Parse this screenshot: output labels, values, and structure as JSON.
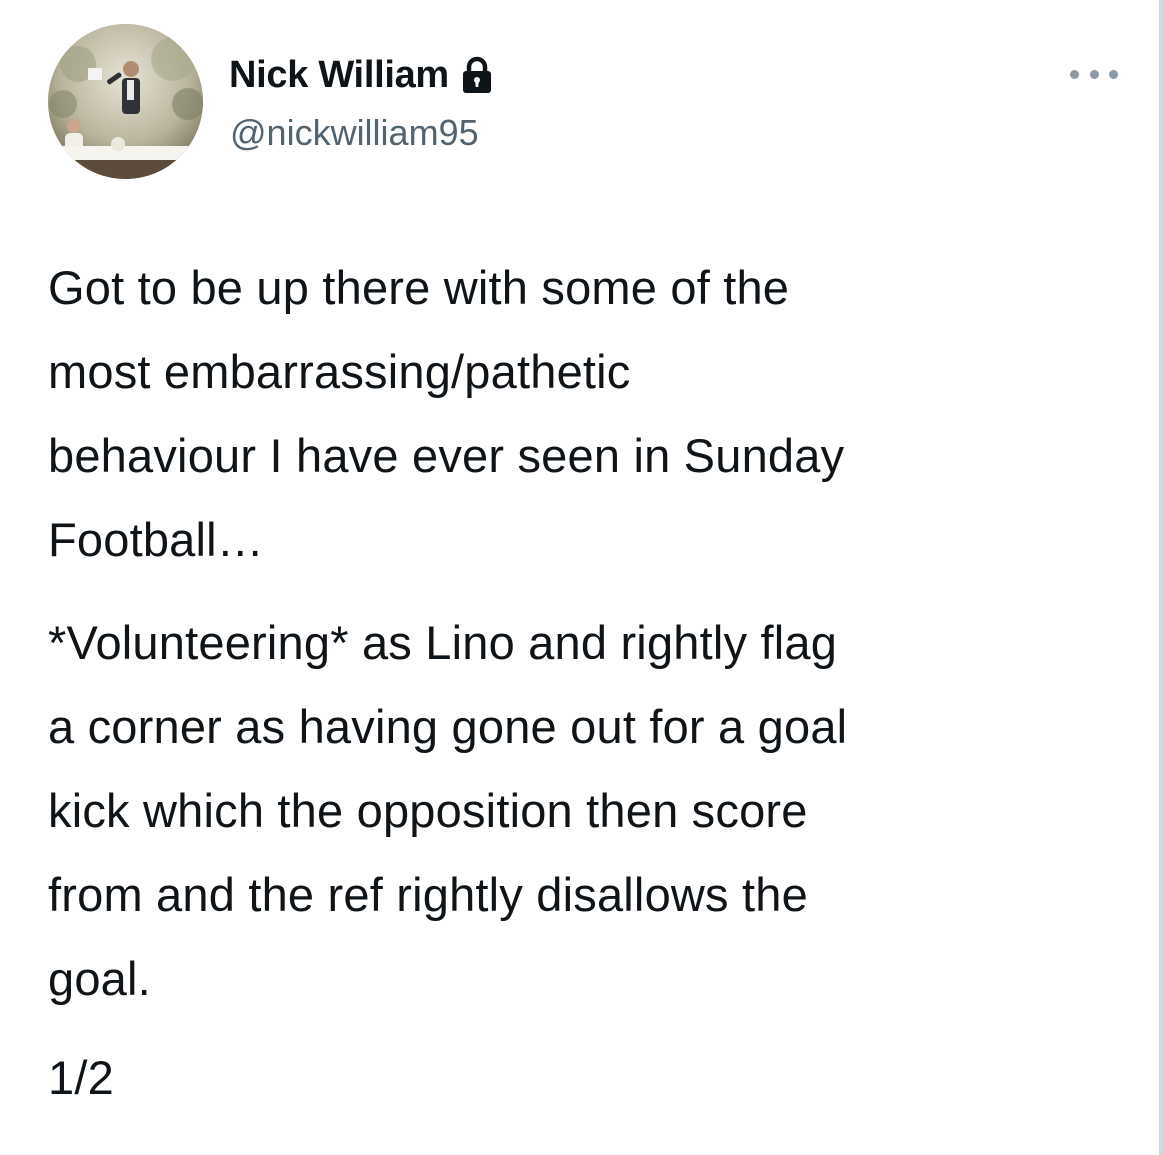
{
  "author": {
    "display_name": "Nick William",
    "handle": "@nickwilliam95",
    "protected_icon": "lock-icon",
    "avatar": "profile-photo"
  },
  "menu": {
    "icon": "more-horizontal-icon"
  },
  "tweet": {
    "paragraphs": [
      "Got to be up there with some of the\nmost embarrassing/pathetic\nbehaviour I have ever seen in Sunday\nFootball…",
      "*Volunteering* as Lino and rightly flag\na corner as having gone out for a goal\nkick which the opposition then score\nfrom and the ref rightly disallows the\ngoal."
    ],
    "thread_counter": "1/2"
  },
  "colors": {
    "text_primary": "#0f1419",
    "text_secondary": "#536471",
    "background": "#ffffff"
  }
}
